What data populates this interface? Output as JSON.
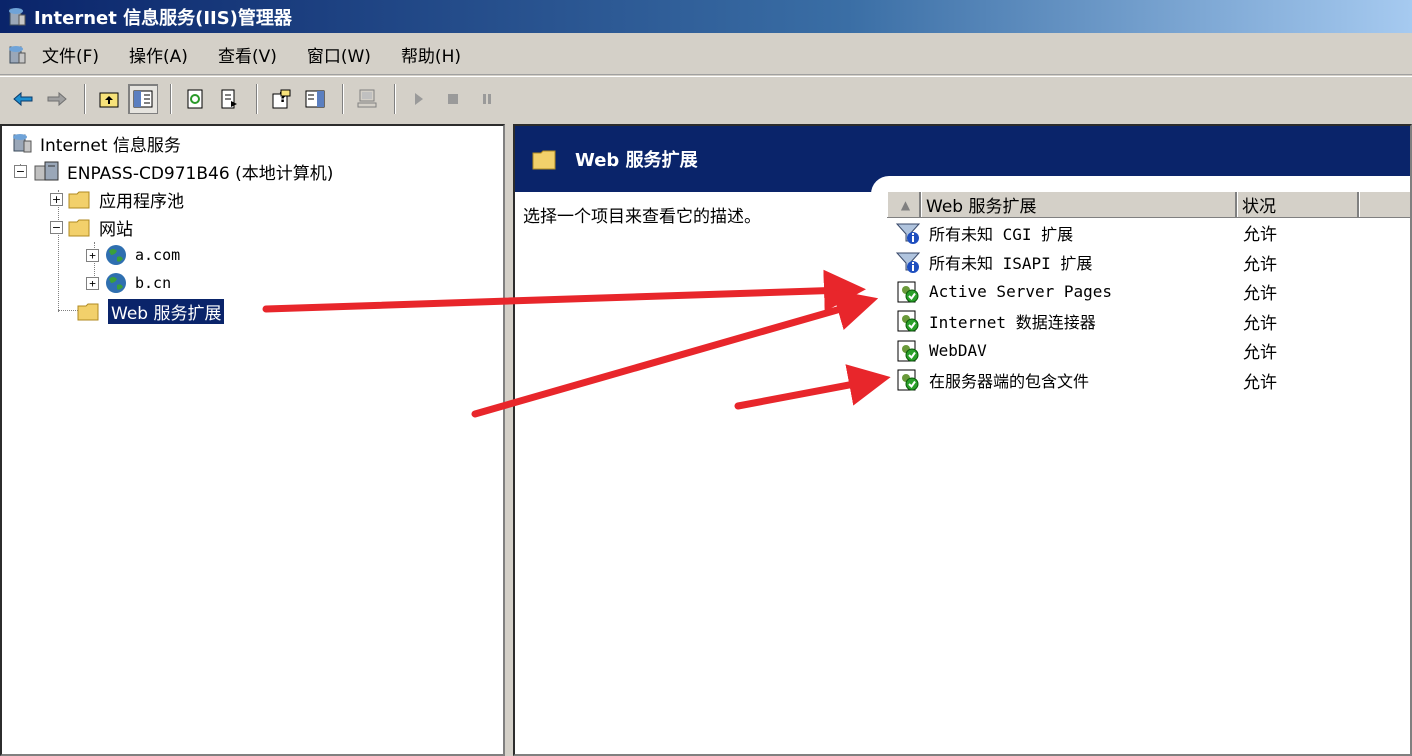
{
  "window": {
    "title": "Internet 信息服务(IIS)管理器"
  },
  "menu": [
    "文件(F)",
    "操作(A)",
    "查看(V)",
    "窗口(W)",
    "帮助(H)"
  ],
  "tree": {
    "root": "Internet 信息服务",
    "computer": "ENPASS-CD971B46 (本地计算机)",
    "app_pools": "应用程序池",
    "websites": "网站",
    "site1": "a.com",
    "site2": "b.cn",
    "web_ext": "Web 服务扩展"
  },
  "right": {
    "banner_title": "Web 服务扩展",
    "description": "选择一个项目来查看它的描述。",
    "columns": {
      "name": "Web 服务扩展",
      "status": "状况"
    },
    "rows": [
      {
        "name": "所有未知 CGI 扩展",
        "status": "允许",
        "icon": "filter-blue-icon"
      },
      {
        "name": "所有未知 ISAPI 扩展",
        "status": "允许",
        "icon": "filter-blue-icon"
      },
      {
        "name": "Active Server Pages",
        "status": "允许",
        "icon": "extension-allowed-icon"
      },
      {
        "name": "Internet 数据连接器",
        "status": "允许",
        "icon": "extension-allowed-icon"
      },
      {
        "name": "WebDAV",
        "status": "允许",
        "icon": "extension-allowed-icon"
      },
      {
        "name": "在服务器端的包含文件",
        "status": "允许",
        "icon": "extension-allowed-icon"
      }
    ]
  },
  "colors": {
    "title_dark": "#0a246a",
    "arrow": "#e8262b",
    "face": "#d4d0c8"
  }
}
